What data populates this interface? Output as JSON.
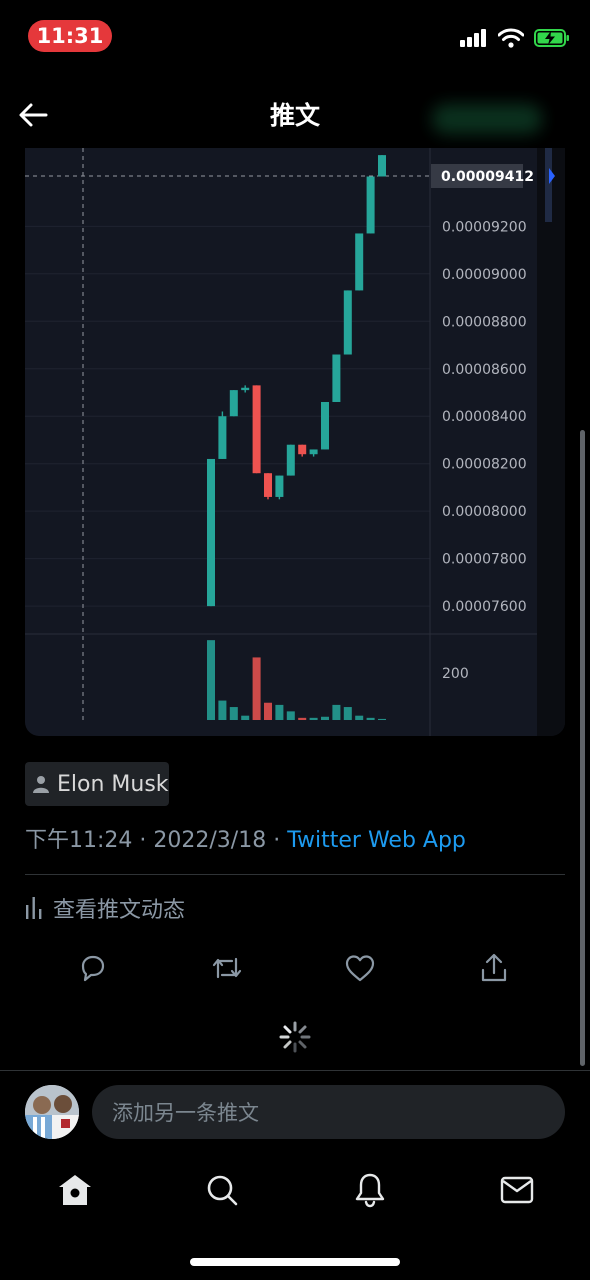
{
  "status_bar": {
    "time": "11:31"
  },
  "header": {
    "title": "推文"
  },
  "chart": {
    "current_price": "0.00009412",
    "price_ticks": [
      "0.00009200",
      "0.00009000",
      "0.00008800",
      "0.00008600",
      "0.00008400",
      "0.00008200",
      "0.00008000",
      "0.00007800",
      "0.00007600"
    ],
    "volume_tick": "200",
    "colors": {
      "up": "#26a69a",
      "down": "#ef5350",
      "background": "#131722"
    }
  },
  "chart_data": {
    "type": "candlestick",
    "ylim": [
      7.55e-05,
      9.53e-05
    ],
    "candles": [
      {
        "open": 7.6e-05,
        "high": 8.22e-05,
        "low": 7.6e-05,
        "close": 8.22e-05
      },
      {
        "open": 8.22e-05,
        "high": 8.42e-05,
        "low": 8.22e-05,
        "close": 8.4e-05
      },
      {
        "open": 8.4e-05,
        "high": 8.51e-05,
        "low": 8.4e-05,
        "close": 8.51e-05
      },
      {
        "open": 8.51e-05,
        "high": 8.53e-05,
        "low": 8.5e-05,
        "close": 8.52e-05
      },
      {
        "open": 8.53e-05,
        "high": 8.53e-05,
        "low": 8.16e-05,
        "close": 8.16e-05
      },
      {
        "open": 8.16e-05,
        "high": 8.16e-05,
        "low": 8.05e-05,
        "close": 8.06e-05
      },
      {
        "open": 8.06e-05,
        "high": 8.15e-05,
        "low": 8.05e-05,
        "close": 8.15e-05
      },
      {
        "open": 8.15e-05,
        "high": 8.28e-05,
        "low": 8.15e-05,
        "close": 8.28e-05
      },
      {
        "open": 8.28e-05,
        "high": 8.28e-05,
        "low": 8.23e-05,
        "close": 8.24e-05
      },
      {
        "open": 8.24e-05,
        "high": 8.26e-05,
        "low": 8.23e-05,
        "close": 8.26e-05
      },
      {
        "open": 8.26e-05,
        "high": 8.46e-05,
        "low": 8.26e-05,
        "close": 8.46e-05
      },
      {
        "open": 8.46e-05,
        "high": 8.66e-05,
        "low": 8.46e-05,
        "close": 8.66e-05
      },
      {
        "open": 8.66e-05,
        "high": 8.93e-05,
        "low": 8.66e-05,
        "close": 8.93e-05
      },
      {
        "open": 8.93e-05,
        "high": 9.17e-05,
        "low": 8.93e-05,
        "close": 9.17e-05
      },
      {
        "open": 9.17e-05,
        "high": 9.41e-05,
        "low": 9.17e-05,
        "close": 9.41e-05
      },
      {
        "open": 9.41e-05,
        "high": 9.5e-05,
        "low": 9.41e-05,
        "close": 9.5e-05
      }
    ],
    "volume": {
      "ylim": [
        0,
        380
      ],
      "values": [
        370,
        90,
        60,
        20,
        290,
        80,
        70,
        40,
        10,
        10,
        15,
        70,
        60,
        20,
        10,
        5
      ]
    }
  },
  "tweet": {
    "author": "Elon Musk",
    "time": "下午11:24",
    "date": "2022/3/18",
    "separator": "·",
    "source": "Twitter Web App",
    "activity_label": "查看推文动态"
  },
  "reply": {
    "placeholder": "添加另一条推文"
  }
}
